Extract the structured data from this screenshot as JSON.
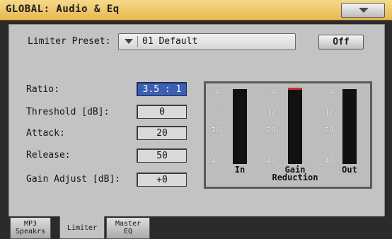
{
  "window": {
    "title": "GLOBAL: Audio & Eq",
    "menu_icon": "chevron-down-icon"
  },
  "preset": {
    "label": "Limiter Preset:",
    "value": "01 Default",
    "off_label": "Off"
  },
  "params": [
    {
      "label": "Ratio:",
      "value": "3.5 : 1"
    },
    {
      "label": "Threshold [dB]:",
      "value": "0"
    },
    {
      "label": "Attack:",
      "value": "20"
    },
    {
      "label": "Release:",
      "value": "50"
    },
    {
      "label": "Gain Adjust [dB]:",
      "value": "+0"
    }
  ],
  "meters": {
    "scale": [
      "0-",
      "12-",
      "20-",
      "40-"
    ],
    "in_label": "In",
    "gain_label_1": "Gain",
    "gain_label_2": "Reduction",
    "out_label": "Out"
  },
  "tabs": [
    {
      "line1": "MP3",
      "line2": "Speakrs"
    },
    {
      "line1": "Limiter",
      "line2": ""
    },
    {
      "line1": "Master",
      "line2": "EQ"
    }
  ],
  "colors": {
    "title_bg": "#e7b94f",
    "panel": "#c3c3c3",
    "selected_field": "#3d5fb3",
    "meter_peak": "#cc2a2a"
  }
}
